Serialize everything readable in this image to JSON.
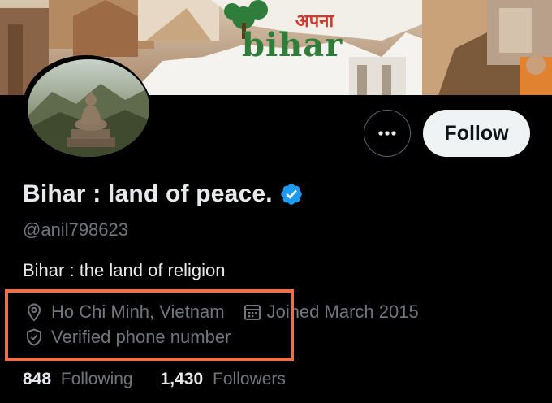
{
  "banner": {
    "logo_hindi": "अपना",
    "logo_text": "bihar"
  },
  "profile": {
    "display_name": "Bihar : land of peace.",
    "handle": "@anil798623",
    "bio": "Bihar : the land of religion",
    "location": "Ho Chi Minh, Vietnam",
    "joined": "Joined March 2015",
    "verified_phone": "Verified phone number",
    "verified_badge_icon": "verified-badge-icon",
    "accent_color": "#1d9bf0",
    "highlight_color": "#ef6f4a"
  },
  "actions": {
    "more_icon": "more-horizontal-icon",
    "follow_label": "Follow"
  },
  "stats": {
    "following_count": "848",
    "following_label": "Following",
    "followers_count": "1,430",
    "followers_label": "Followers"
  }
}
